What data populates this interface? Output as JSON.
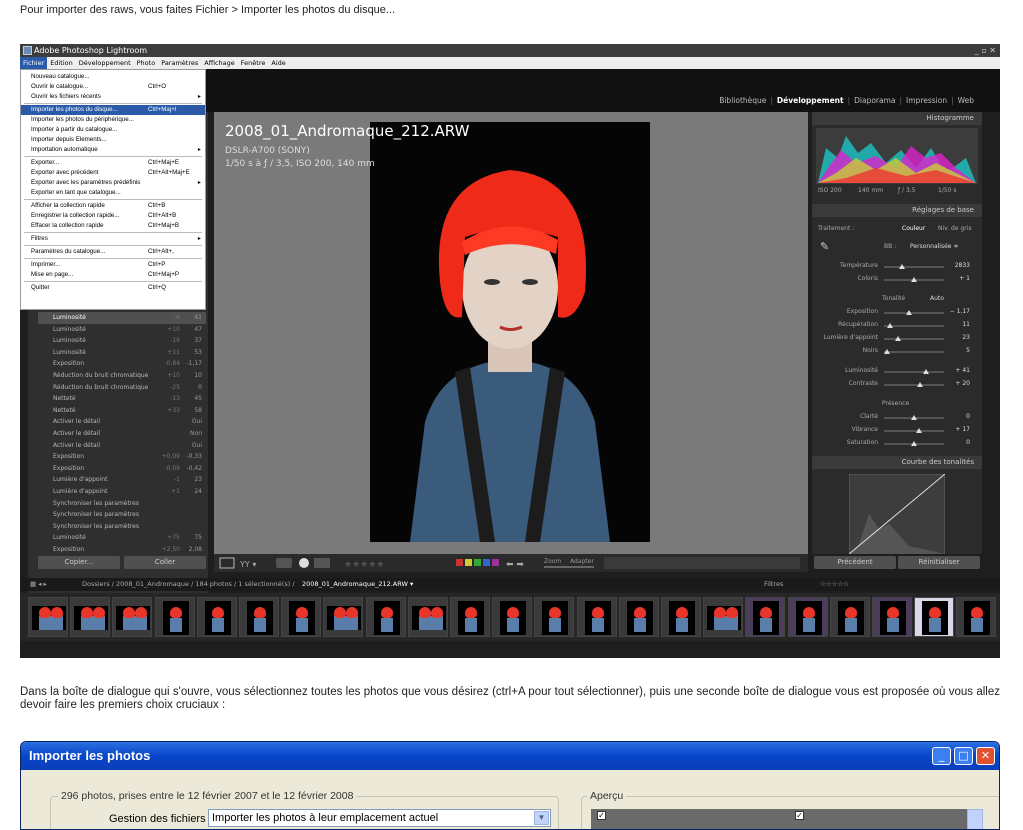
{
  "intro": "Pour importer des raws, vous faites Fichier > Importer les photos du disque...",
  "paragraph": "Dans la boîte de dialogue qui s'ouvre, vous sélectionnez toutes les photos que vous désirez (ctrl+A pour tout sélectionner), puis une seconde boîte de dialogue vous est proposée où vous allez devoir faire les premiers choix cruciaux :",
  "lightroom": {
    "title": "Adobe Photoshop Lightroom",
    "menubar": [
      "Fichier",
      "Edition",
      "Développement",
      "Photo",
      "Paramètres",
      "Affichage",
      "Fenêtre",
      "Aide"
    ],
    "modules": [
      "Bibliothèque",
      "Développement",
      "Diaporama",
      "Impression",
      "Web"
    ],
    "active_module": "Développement",
    "overlay": {
      "filename": "2008_01_Andromaque_212.ARW",
      "camera": "DSLR-A700 (SONY)",
      "exposure": "1/50 s à ƒ / 3,5, ISO 200, 140 mm"
    },
    "file_menu": [
      {
        "label": "Nouveau catalogue...",
        "shortcut": ""
      },
      {
        "label": "Ouvrir le catalogue...",
        "shortcut": "Ctrl+O"
      },
      {
        "label": "Ouvrir les fichiers récents",
        "shortcut": "",
        "arrow": "▸"
      },
      {
        "label": "Importer les photos du disque...",
        "shortcut": "Ctrl+Maj+I",
        "highlighted": true
      },
      {
        "label": "Importer les photos du périphérique...",
        "shortcut": ""
      },
      {
        "label": "Importer à partir du catalogue...",
        "shortcut": ""
      },
      {
        "label": "Importer depuis Elements...",
        "shortcut": ""
      },
      {
        "label": "Importation automatique",
        "shortcut": "",
        "arrow": "▸"
      },
      {
        "label": "Exporter...",
        "shortcut": "Ctrl+Maj+E"
      },
      {
        "label": "Exporter avec précédent",
        "shortcut": "Ctrl+Alt+Maj+E"
      },
      {
        "label": "Exporter avec les paramètres prédéfinis",
        "shortcut": "",
        "arrow": "▸"
      },
      {
        "label": "Exporter en tant que catalogue...",
        "shortcut": ""
      },
      {
        "label": "Afficher la collection rapide",
        "shortcut": "Ctrl+B"
      },
      {
        "label": "Enregistrer la collection rapide...",
        "shortcut": "Ctrl+Alt+B"
      },
      {
        "label": "Effacer la collection rapide",
        "shortcut": "Ctrl+Maj+B"
      },
      {
        "label": "Filtres",
        "shortcut": "",
        "arrow": "▸"
      },
      {
        "label": "Paramètres du catalogue...",
        "shortcut": "Ctrl+Alt+,"
      },
      {
        "label": "Imprimer...",
        "shortcut": "Ctrl+P"
      },
      {
        "label": "Mise en page...",
        "shortcut": "Ctrl+Maj+P"
      },
      {
        "label": "Quitter",
        "shortcut": "Ctrl+Q"
      }
    ],
    "history": [
      {
        "label": "Luminosité",
        "v1": "-6",
        "v2": "41",
        "sel": true
      },
      {
        "label": "Luminosité",
        "v1": "+10",
        "v2": "47"
      },
      {
        "label": "Luminosité",
        "v1": "-16",
        "v2": "37"
      },
      {
        "label": "Luminosité",
        "v1": "+11",
        "v2": "53"
      },
      {
        "label": "Exposition",
        "v1": "-0,84",
        "v2": "-1,17"
      },
      {
        "label": "Réduction du bruit chromatique",
        "v1": "+10",
        "v2": "10"
      },
      {
        "label": "Réduction du bruit chromatique",
        "v1": "-25",
        "v2": "0"
      },
      {
        "label": "Netteté",
        "v1": "-13",
        "v2": "45"
      },
      {
        "label": "Netteté",
        "v1": "+33",
        "v2": "58"
      },
      {
        "label": "Activer le détail",
        "v1": "",
        "v2": "Oui"
      },
      {
        "label": "Activer le détail",
        "v1": "",
        "v2": "Non"
      },
      {
        "label": "Activer le détail",
        "v1": "",
        "v2": "Oui"
      },
      {
        "label": "Exposition",
        "v1": "+0,09",
        "v2": "-0,33"
      },
      {
        "label": "Exposition",
        "v1": "-0,09",
        "v2": "-0,42"
      },
      {
        "label": "Lumière d'appoint",
        "v1": "-1",
        "v2": "23"
      },
      {
        "label": "Lumière d'appoint",
        "v1": "+1",
        "v2": "24"
      },
      {
        "label": "Synchroniser les paramètres",
        "v1": "",
        "v2": ""
      },
      {
        "label": "Synchroniser les paramètres",
        "v1": "",
        "v2": ""
      },
      {
        "label": "Synchroniser les paramètres",
        "v1": "",
        "v2": ""
      },
      {
        "label": "Luminosité",
        "v1": "+75",
        "v2": "75"
      },
      {
        "label": "Exposition",
        "v1": "+2,50",
        "v2": "2,08"
      }
    ],
    "copy_label": "Copier...",
    "paste_label": "Coller",
    "right": {
      "histogram": "Histogramme",
      "hist_info": [
        "ISO 200",
        "140 mm",
        "ƒ / 3,5",
        "1/50 s"
      ],
      "basic": "Réglages de base",
      "treatment": "Traitement :",
      "color": "Couleur",
      "bw": "Niv. de gris",
      "wb": "BB :",
      "wb_value": "Personnalisée ≑",
      "rows1": [
        {
          "label": "Température",
          "value": "2833",
          "pos": 0.3
        },
        {
          "label": "Coloris",
          "value": "+ 1",
          "pos": 0.5
        }
      ],
      "tone": "Tonalité",
      "auto": "Auto",
      "rows2": [
        {
          "label": "Exposition",
          "value": "− 1,17",
          "pos": 0.42
        },
        {
          "label": "Récupération",
          "value": "11",
          "pos": 0.1
        },
        {
          "label": "Lumière d'appoint",
          "value": "23",
          "pos": 0.23
        },
        {
          "label": "Noirs",
          "value": "5",
          "pos": 0.05
        },
        {
          "label": "Luminosité",
          "value": "+ 41",
          "pos": 0.7
        },
        {
          "label": "Contraste",
          "value": "+ 20",
          "pos": 0.6
        }
      ],
      "presence": "Présence",
      "rows3": [
        {
          "label": "Clarté",
          "value": "0",
          "pos": 0.5
        },
        {
          "label": "Vibrance",
          "value": "+ 17",
          "pos": 0.58
        },
        {
          "label": "Saturation",
          "value": "0",
          "pos": 0.5
        }
      ],
      "curve": "Courbe des tonalités",
      "prev_btn": "Précédent",
      "reset_btn": "Réinitialiser"
    },
    "toolbar": {
      "zoom": "Zoom",
      "fit": "Adapter",
      "stars": "★★★★★"
    },
    "filmstrip_path": "Dossiers / 2008_01_Andromaque / 184 photos / 1 sélectionné(s) /",
    "filmstrip_file": "2008_01_Andromaque_212.ARW ▾",
    "filters": "Filtres",
    "filter_stars": "☆☆☆☆☆"
  },
  "dialog": {
    "title": "Importer les photos",
    "group1_label": "296 photos, prises entre le 12 février 2007 et le 12 février 2008",
    "file_handling_label": "Gestion des fichiers :",
    "file_handling_value": "Importer les photos à leur emplacement actuel",
    "group2_label": "Aperçu"
  }
}
